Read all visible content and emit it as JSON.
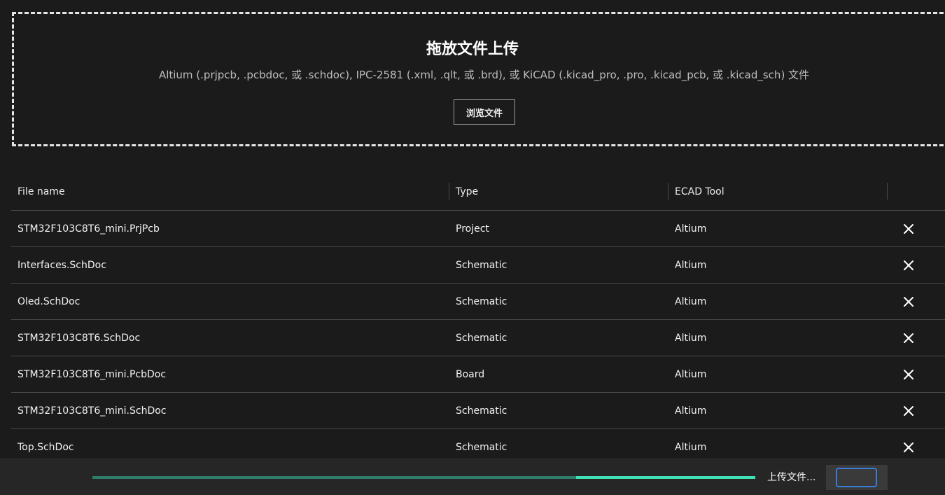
{
  "dropzone": {
    "title": "拖放文件上传",
    "subtitle": "Altium (.prjpcb, .pcbdoc, 或 .schdoc), IPC-2581 (.xml, .qlt, 或 .brd), 或 KiCAD (.kicad_pro, .pro, .kicad_pcb, 或 .kicad_sch) 文件",
    "browse_label": "浏览文件"
  },
  "table": {
    "headers": {
      "file_name": "File name",
      "type": "Type",
      "ecad_tool": "ECAD Tool"
    },
    "rows": [
      {
        "name": "STM32F103C8T6_mini.PrjPcb",
        "type": "Project",
        "tool": "Altium"
      },
      {
        "name": "Interfaces.SchDoc",
        "type": "Schematic",
        "tool": "Altium"
      },
      {
        "name": "Oled.SchDoc",
        "type": "Schematic",
        "tool": "Altium"
      },
      {
        "name": "STM32F103C8T6.SchDoc",
        "type": "Schematic",
        "tool": "Altium"
      },
      {
        "name": "STM32F103C8T6_mini.PcbDoc",
        "type": "Board",
        "tool": "Altium"
      },
      {
        "name": "STM32F103C8T6_mini.SchDoc",
        "type": "Schematic",
        "tool": "Altium"
      },
      {
        "name": "Top.SchDoc",
        "type": "Schematic",
        "tool": "Altium"
      }
    ],
    "delete_icon": "close-icon"
  },
  "footer": {
    "status_text": "上传文件...",
    "progress_fraction": 0.27,
    "colors": {
      "progress_track": "#2e7d6a",
      "progress_fill": "#3ee0b6",
      "action_border": "#3a7bd5"
    }
  }
}
